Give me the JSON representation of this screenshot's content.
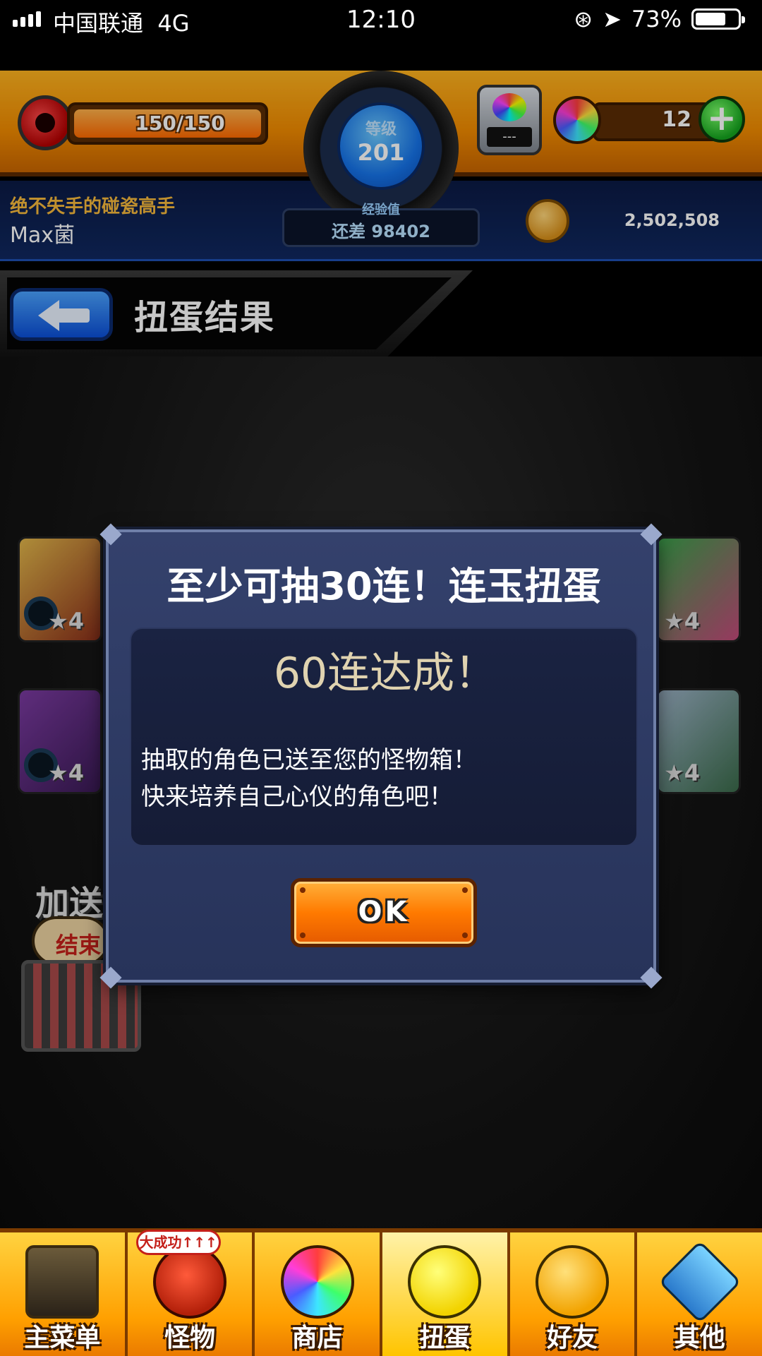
{
  "status_bar": {
    "carrier": "中国联通",
    "network": "4G",
    "time": "12:10",
    "battery": "73%",
    "battery_level": 0.73
  },
  "hud": {
    "stamina": "150/150",
    "level_label": "等级",
    "level": "201",
    "exp_label": "经验值",
    "exp_remaining": "还差 98402",
    "title": "绝不失手的碰瓷高手",
    "player_name": "Max菌",
    "gacha_value": "---",
    "orbs": "12",
    "plus": "+",
    "coins": "2,502,508"
  },
  "header": {
    "title": "扭蛋结果"
  },
  "background": {
    "stars": [
      "★4",
      "★4",
      "★4",
      "★4"
    ],
    "bonus_text": "加送",
    "bonus_bubble": "结束"
  },
  "dialog": {
    "title": "至少可抽30连！连玉扭蛋",
    "headline": "60连达成！",
    "line1": "抽取的角色已送至您的怪物箱！",
    "line2": "快来培养自己心仪的角色吧！",
    "ok_label": "OK"
  },
  "nav": {
    "items": [
      {
        "label": "主菜单",
        "icon": "gate-icon"
      },
      {
        "label": "怪物",
        "icon": "monster-icon",
        "badge": "大成功↑↑↑"
      },
      {
        "label": "商店",
        "icon": "orb-icon"
      },
      {
        "label": "扭蛋",
        "icon": "egg-icon"
      },
      {
        "label": "好友",
        "icon": "friends-icon"
      },
      {
        "label": "其他",
        "icon": "settings-icon"
      }
    ]
  },
  "colors": {
    "hud_orange": "#f08a00",
    "hud_blue": "#10285f",
    "dialog_bg": "#34416c",
    "ok_orange": "#ff7a00",
    "nav_gold": "#ffcb2a"
  }
}
